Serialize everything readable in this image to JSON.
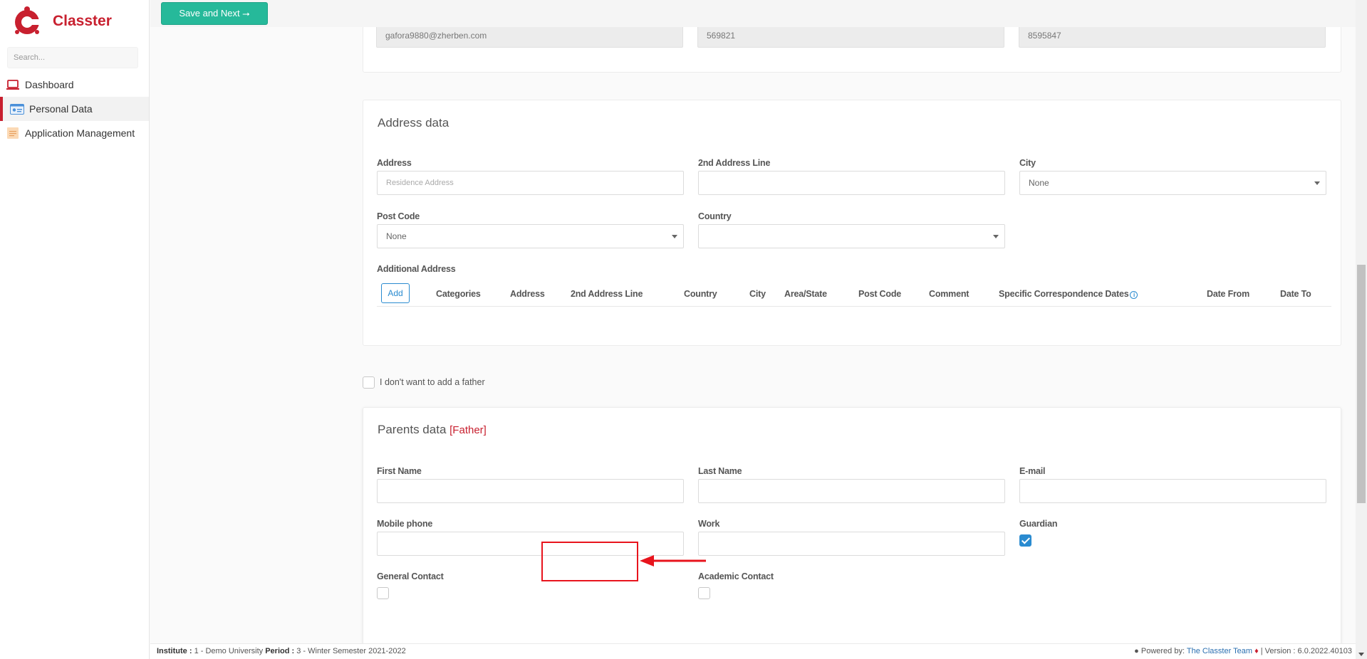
{
  "brand": {
    "name": "Classter"
  },
  "sidebar": {
    "search_placeholder": "Search...",
    "items": [
      {
        "label": "Dashboard"
      },
      {
        "label": "Personal Data"
      },
      {
        "label": "Application Management"
      }
    ]
  },
  "toolbar": {
    "save_next_label": "Save and Next ⭢"
  },
  "contact_row": {
    "email": "gafora9880@zherben.com",
    "field2": "569821",
    "field3": "8595847"
  },
  "address": {
    "title": "Address data",
    "address_label": "Address",
    "address_placeholder": "Residence Address",
    "address2_label": "2nd Address Line",
    "city_label": "City",
    "city_value": "None",
    "postcode_label": "Post Code",
    "postcode_value": "None",
    "country_label": "Country",
    "country_value": "",
    "additional_label": "Additional Address",
    "add_button": "Add",
    "columns": [
      "Categories",
      "Address",
      "2nd Address Line",
      "Country",
      "City",
      "Area/State",
      "Post Code",
      "Comment",
      "Specific Correspondence Dates",
      "Date From",
      "Date To"
    ]
  },
  "no_father_label": "I don't want to add a father",
  "parents": {
    "title": "Parents data",
    "tag": "[Father]",
    "first_name_label": "First Name",
    "last_name_label": "Last Name",
    "email_label": "E-mail",
    "mobile_label": "Mobile phone",
    "work_label": "Work",
    "guardian_label": "Guardian",
    "guardian_checked": true,
    "general_contact_label": "General Contact",
    "general_contact_checked": false,
    "academic_contact_label": "Academic Contact",
    "academic_contact_checked": false
  },
  "footer": {
    "institute_label": "Institute :",
    "institute_value": "1 - Demo University",
    "period_label": "Period :",
    "period_value": "3 - Winter Semester 2021-2022",
    "powered_by": "Powered by:",
    "team_link": "The Classter Team",
    "version": "| Version : 6.0.2022.40103"
  },
  "colors": {
    "brand": "#c8202f",
    "accent_green": "#26b99a",
    "link_blue": "#2a8bd0",
    "annotation_red": "#e8141d"
  }
}
